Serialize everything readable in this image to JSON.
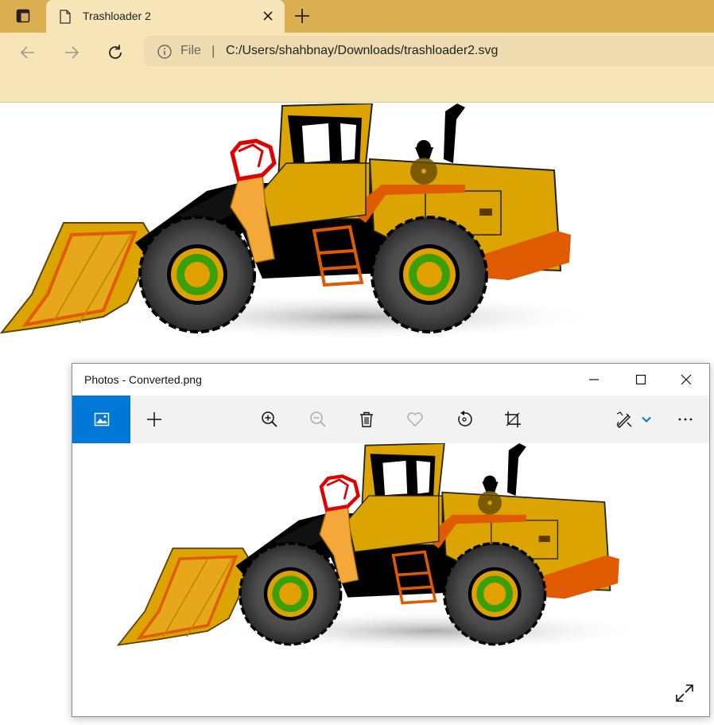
{
  "browser": {
    "tab": {
      "title": "Trashloader 2",
      "favicon": "file-icon",
      "close_icon": "close-icon"
    },
    "new_tab_icon": "plus-icon",
    "tab_actions_icon": "tab-actions-icon",
    "nav": {
      "back_icon": "arrow-left-icon",
      "forward_icon": "arrow-right-icon",
      "refresh_icon": "refresh-icon"
    },
    "address": {
      "info_icon": "info-icon",
      "scheme": "File",
      "separator": "|",
      "url": "C:/Users/shahbnay/Downloads/trashloader2.svg"
    },
    "colors": {
      "tabstrip": "#dcae52",
      "toolbar": "#f7e5b7",
      "address": "#efdbb0"
    }
  },
  "photos_window": {
    "title": "Photos - Converted.png",
    "window_controls": [
      "minimize-icon",
      "maximize-icon",
      "close-icon"
    ],
    "commands": {
      "gallery_icon": "image-icon",
      "add_icon": "plus-icon",
      "zoom_in_icon": "zoom-in-icon",
      "zoom_out_icon": "zoom-out-icon",
      "delete_icon": "trash-icon",
      "favorite_icon": "heart-icon",
      "rotate_icon": "rotate-icon",
      "crop_icon": "crop-icon",
      "edit_icon": "edit-draw-icon",
      "dropdown_icon": "chevron-down-icon",
      "more_icon": "more-icon"
    },
    "expand_icon": "expand-icon",
    "colors": {
      "accent": "#0078d7"
    }
  },
  "artwork": {
    "subject": "wheel loader",
    "colors": {
      "body": "#dca400",
      "accent_orange": "#e05a00",
      "seat": "#f4a83a",
      "tire": "#3a3a3a",
      "hub_green": "#3aa00a",
      "hub_yellow": "#e0a000",
      "seatbelt_red": "#e00000"
    }
  }
}
